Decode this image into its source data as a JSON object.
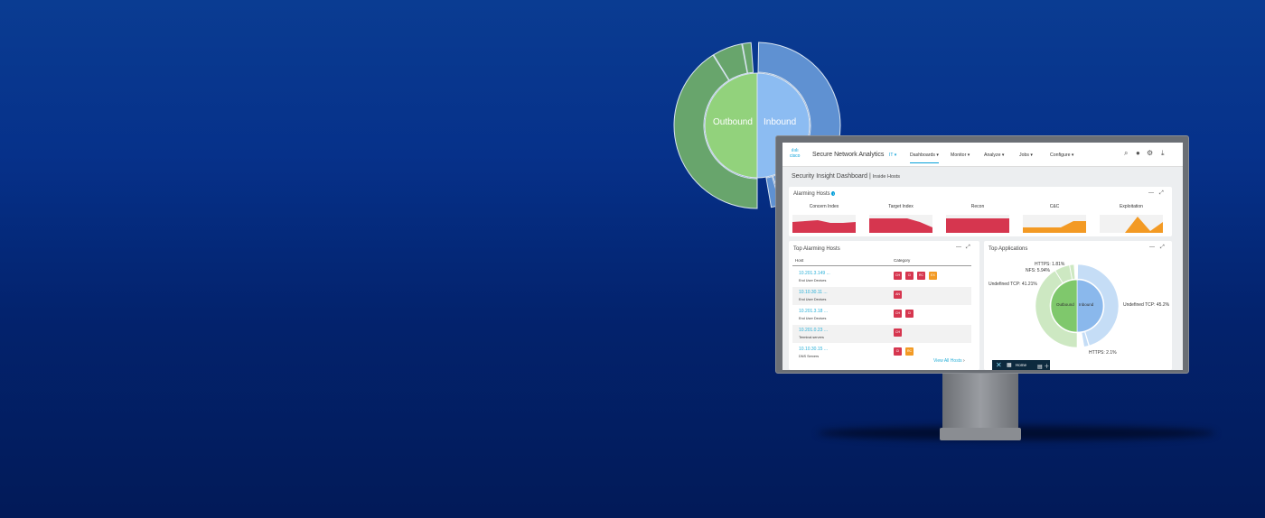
{
  "hero_chart": {
    "outbound_label": "Outbound",
    "inbound_label": "Inbound"
  },
  "app": {
    "title": "Secure Network Analytics",
    "brand": "cisco",
    "domain_selector": "IT ▾",
    "nav": [
      "Dashboards ▾",
      "Monitor ▾",
      "Analyze ▾",
      "Jobs ▾",
      "Configure ▾"
    ],
    "icons": [
      "search-icon",
      "user-icon",
      "gear-icon",
      "download-icon"
    ]
  },
  "breadcrumb": {
    "dashboard": "Security Insight Dashboard",
    "separator": "|",
    "page": "Inside Hosts"
  },
  "alarming_hosts": {
    "title": "Alarming Hosts",
    "info": "i",
    "minimize": "—",
    "expand": "⤢",
    "metrics": [
      {
        "label": "Concern Index",
        "color": "#d6364f"
      },
      {
        "label": "Target Index",
        "color": "#d6364f"
      },
      {
        "label": "Recon",
        "color": "#d6364f"
      },
      {
        "label": "C&C",
        "color": "#f39a24"
      },
      {
        "label": "Exploitation",
        "color": "#f39a24"
      }
    ]
  },
  "top_alarming_hosts": {
    "title": "Top Alarming Hosts",
    "minimize": "—",
    "expand": "⤢",
    "col_host": "Host",
    "col_category": "Category",
    "rows": [
      {
        "ip": "10.201.3.149 ...",
        "group": "End User Devices",
        "badges": [
          [
            "CH",
            "#d6364f"
          ],
          [
            "CI",
            "#d6364f"
          ],
          [
            "RC",
            "#d6364f"
          ],
          [
            "EX",
            "#f39a24"
          ]
        ]
      },
      {
        "ip": "10.10.30.11 ...",
        "group": "End User Devices",
        "badges": [
          [
            "AN",
            "#d6364f"
          ]
        ]
      },
      {
        "ip": "10.201.3.18 ...",
        "group": "End User Devices",
        "badges": [
          [
            "CH",
            "#d6364f"
          ],
          [
            "CI",
            "#d6364f"
          ]
        ]
      },
      {
        "ip": "10.201.0.23 ...",
        "group": "Terminal servers",
        "badges": [
          [
            "CH",
            "#d6364f"
          ]
        ]
      },
      {
        "ip": "10.10.30.15 ...",
        "group": "DNS Servers",
        "badges": [
          [
            "CI",
            "#d6364f"
          ],
          [
            "RC",
            "#f39a24"
          ]
        ]
      }
    ],
    "view_all": "View All Hosts"
  },
  "top_applications": {
    "title": "Top Applications",
    "minimize": "—",
    "expand": "⤢",
    "chart_data": {
      "type": "pie",
      "outbound_label": "Outbound",
      "inbound_label": "Inbound",
      "outbound": [
        {
          "name": "Undefined TCP",
          "value": 41.21,
          "label": "Undefined TCP: 41.21%"
        },
        {
          "name": "NFS",
          "value": 5.94,
          "label": "NFS: 5.94%"
        },
        {
          "name": "HTTPS",
          "value": 1.81,
          "label": "HTTPS: 1.81%"
        }
      ],
      "inbound": [
        {
          "name": "Undefined TCP",
          "value": 45.2,
          "label": "Undefined TCP: 45.2%"
        },
        {
          "name": "HTTPS",
          "value": 2.1,
          "label": "HTTPS: 2.1%"
        }
      ]
    }
  },
  "dock": {
    "home": "Home"
  }
}
